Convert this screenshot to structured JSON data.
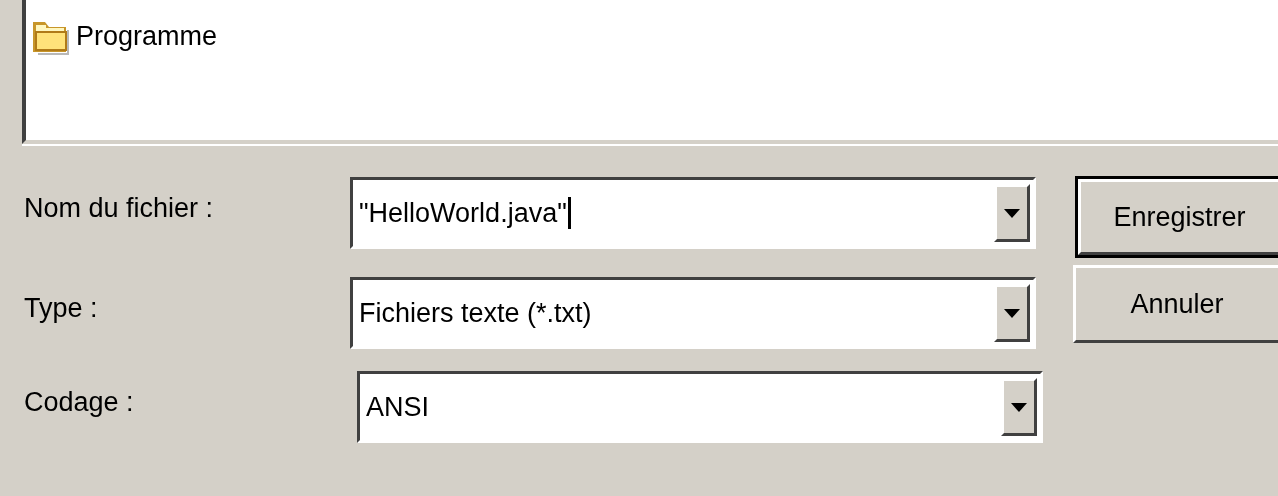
{
  "file_list": {
    "items": [
      {
        "name": "Programme",
        "kind": "folder"
      }
    ]
  },
  "fields": [
    {
      "label": "Nom du fichier :",
      "value": "\"HelloWorld.java\"",
      "focused": true
    },
    {
      "label": "Type :",
      "value": "Fichiers texte (*.txt)",
      "focused": false
    },
    {
      "label": "Codage :",
      "value": "ANSI",
      "focused": false
    }
  ],
  "buttons": [
    {
      "label": "Enregistrer",
      "default": true
    },
    {
      "label": "Annuler",
      "default": false
    }
  ]
}
